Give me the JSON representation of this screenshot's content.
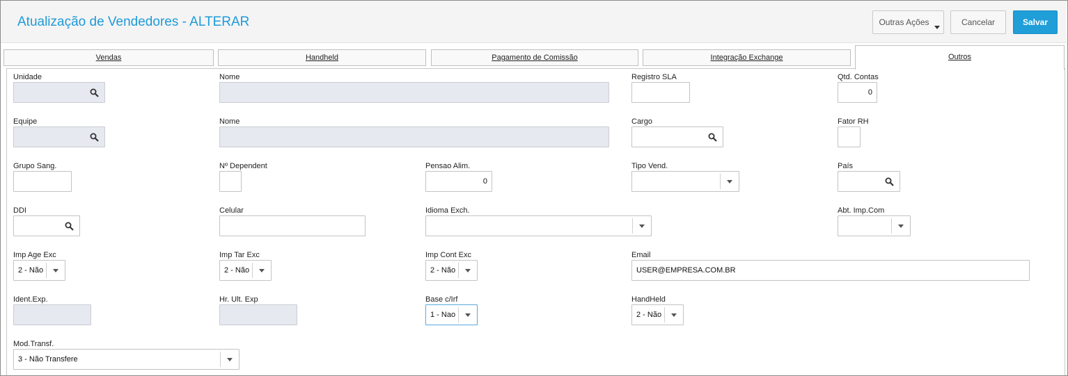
{
  "header": {
    "title": "Atualização de Vendedores - ALTERAR",
    "other_actions": "Outras Ações",
    "cancel": "Cancelar",
    "save": "Salvar"
  },
  "tabs": [
    "Vendas",
    "Handheld",
    "Pagamento de Comissão",
    "Integração Exchange",
    "Outros"
  ],
  "active_tab": "Outros",
  "fields": {
    "unidade": {
      "label": "Unidade",
      "value": ""
    },
    "nome1": {
      "label": "Nome",
      "value": ""
    },
    "registro_sla": {
      "label": "Registro SLA",
      "value": ""
    },
    "qtd_contas": {
      "label": "Qtd. Contas",
      "value": "0"
    },
    "equipe": {
      "label": "Equipe",
      "value": ""
    },
    "nome2": {
      "label": "Nome",
      "value": ""
    },
    "cargo": {
      "label": "Cargo",
      "value": ""
    },
    "fator_rh": {
      "label": "Fator RH",
      "value": ""
    },
    "grupo_sang": {
      "label": "Grupo Sang.",
      "value": ""
    },
    "n_dependent": {
      "label": "Nº Dependent",
      "value": ""
    },
    "pensao_alim": {
      "label": "Pensao Alim.",
      "value": "0"
    },
    "tipo_vend": {
      "label": "Tipo Vend.",
      "value": ""
    },
    "pais": {
      "label": "País",
      "value": ""
    },
    "ddi": {
      "label": "DDI",
      "value": ""
    },
    "celular": {
      "label": "Celular",
      "value": ""
    },
    "idioma_exch": {
      "label": "Idioma Exch.",
      "value": ""
    },
    "abt_imp_com": {
      "label": "Abt. Imp.Com",
      "value": ""
    },
    "imp_age_exc": {
      "label": "Imp Age Exc",
      "value": "2 - Não"
    },
    "imp_tar_exc": {
      "label": "Imp Tar Exc",
      "value": "2 - Não"
    },
    "imp_cont_exc": {
      "label": "Imp Cont Exc",
      "value": "2 - Não"
    },
    "email": {
      "label": "Email",
      "value": "USER@EMPRESA.COM.BR"
    },
    "ident_exp": {
      "label": "Ident.Exp.",
      "value": ""
    },
    "hr_ult_exp": {
      "label": "Hr. Ult. Exp",
      "value": ""
    },
    "base_c_irf": {
      "label": "Base c/Irf",
      "value": "1 - Nao"
    },
    "handheld": {
      "label": "HandHeld",
      "value": "2 - Não"
    },
    "mod_transf": {
      "label": "Mod.Transf.",
      "value": "3 - Não Transfere"
    }
  },
  "colors": {
    "accent": "#1e9ad8",
    "save_button": "#1f9ed8",
    "readonly_field": "#e6e9ef"
  },
  "icons": {
    "lookup": "magnifier-icon",
    "dropdown": "chevron-down-icon"
  }
}
